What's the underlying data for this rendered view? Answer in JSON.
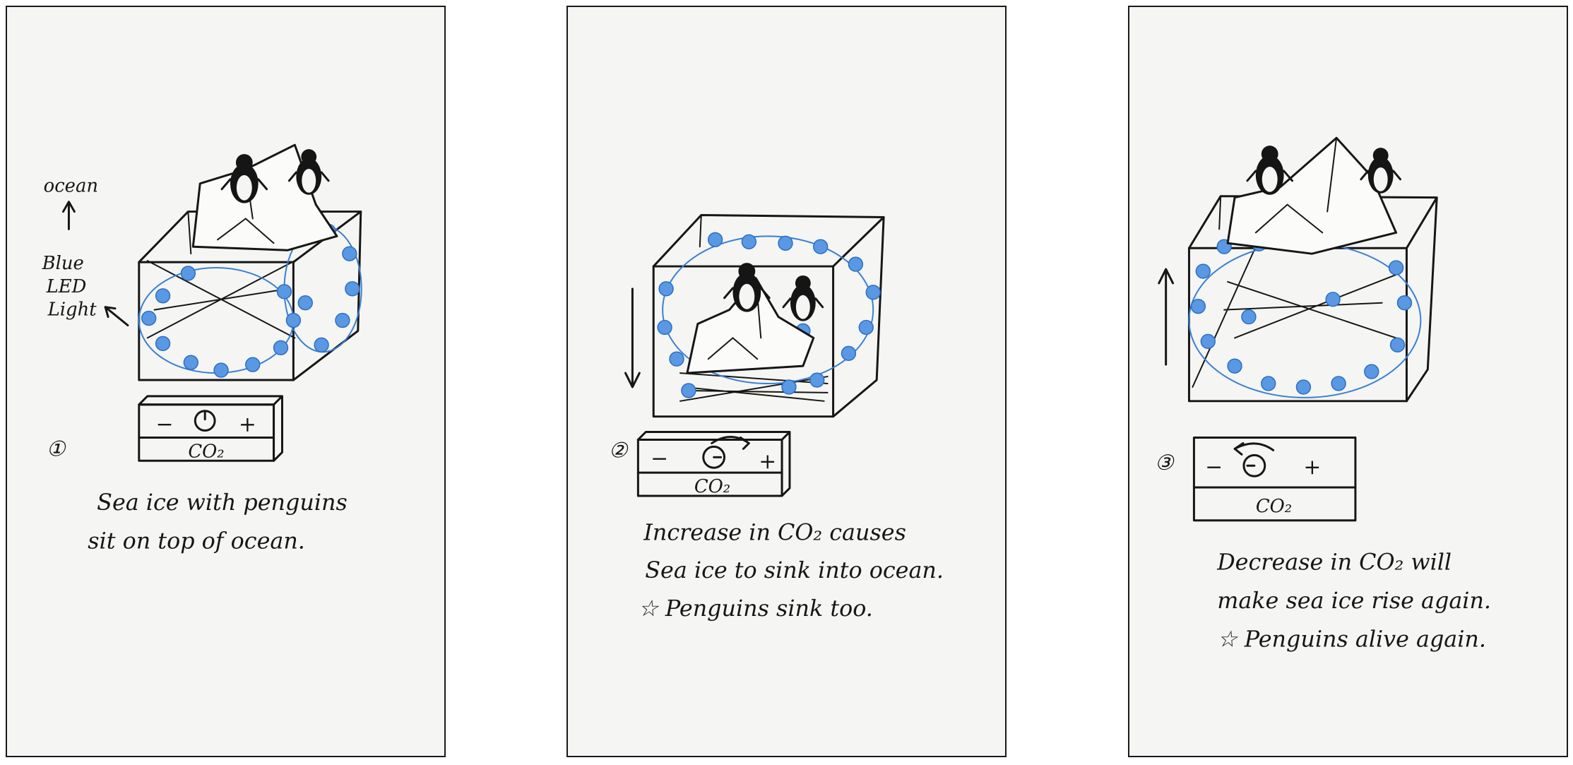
{
  "panels": [
    {
      "number": "①",
      "control": {
        "minus": "−",
        "plus": "+",
        "label": "CO₂"
      },
      "side_labels": {
        "ocean": "ocean",
        "blue": "Blue",
        "led": "LED",
        "light": "Light"
      },
      "caption": [
        "Sea ice with penguins",
        "sit on top of ocean."
      ]
    },
    {
      "number": "②",
      "control": {
        "minus": "−",
        "plus": "+",
        "label": "CO₂"
      },
      "caption": [
        "Increase in CO₂ causes",
        "Sea ice to sink into ocean.",
        "☆ Penguins sink too."
      ]
    },
    {
      "number": "③",
      "control": {
        "minus": "−",
        "plus": "+",
        "label": "CO₂"
      },
      "caption": [
        "Decrease in CO₂ will",
        "make sea ice rise again.",
        "☆ Penguins alive again."
      ]
    }
  ],
  "colors": {
    "ink": "#161616",
    "led_blue": "#5a98e3",
    "paper": "#f5f5f3"
  }
}
